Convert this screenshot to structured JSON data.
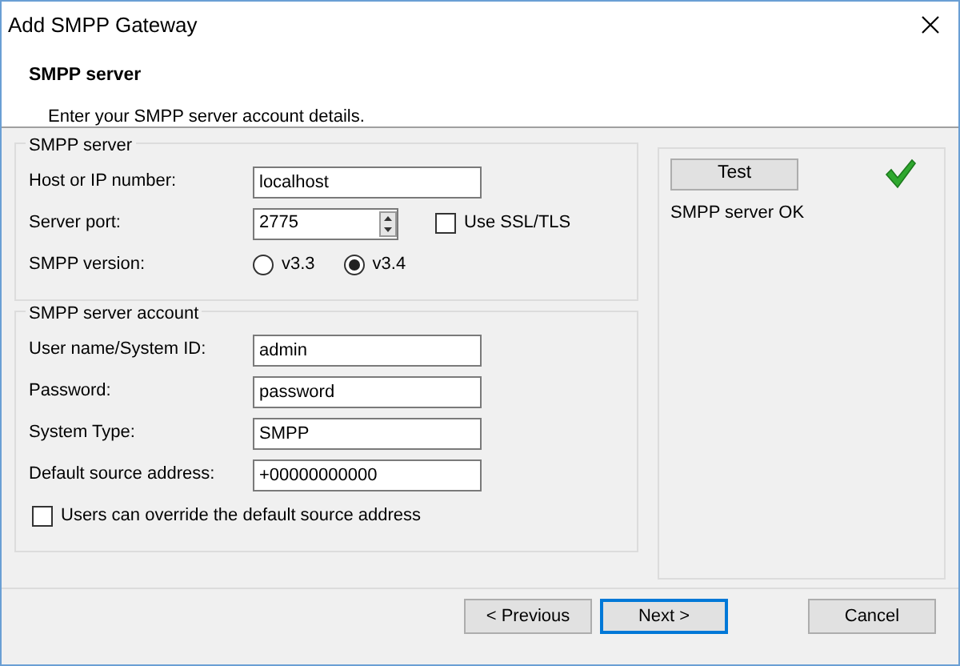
{
  "window": {
    "title": "Add SMPP Gateway"
  },
  "header": {
    "title": "SMPP server",
    "subtitle": "Enter your SMPP server account details."
  },
  "groups": [
    {
      "title": "SMPP server",
      "rows": [
        {
          "kind": "text",
          "label": "Host or IP number:",
          "value": "localhost"
        },
        {
          "kind": "spinner",
          "label": "Server port:",
          "value": "2775",
          "checkbox": {
            "label": "Use SSL/TLS",
            "checked": false
          }
        },
        {
          "kind": "radio",
          "label": "SMPP version:",
          "options": [
            {
              "label": "v3.3",
              "selected": false
            },
            {
              "label": "v3.4",
              "selected": true
            }
          ]
        }
      ]
    },
    {
      "title": "SMPP server account",
      "rows": [
        {
          "kind": "text",
          "label": "User name/System ID:",
          "value": "admin"
        },
        {
          "kind": "text",
          "label": "Password:",
          "value": "password"
        },
        {
          "kind": "text",
          "label": "System Type:",
          "value": "SMPP"
        },
        {
          "kind": "text",
          "label": "Default source address:",
          "value": "+00000000000"
        },
        {
          "kind": "checkbox",
          "label": "Users can override the default source address",
          "checked": false
        }
      ]
    }
  ],
  "test_panel": {
    "button": "Test",
    "status": "SMPP server OK",
    "ok": true
  },
  "buttons": [
    {
      "label": "< Previous",
      "default": false
    },
    {
      "label": "Next >",
      "default": true
    },
    {
      "label": "Cancel",
      "default": false
    }
  ]
}
